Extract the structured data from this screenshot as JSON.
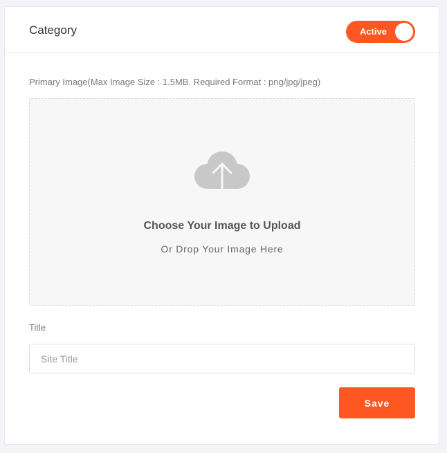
{
  "header": {
    "title": "Category",
    "status_toggle": {
      "label": "Active",
      "on": true
    }
  },
  "image_upload": {
    "label": "Primary Image(Max Image Size : 1.5MB. Required Format : png/jpg/jpeg)",
    "title": "Choose Your Image to Upload",
    "subtitle": "Or Drop Your Image Here",
    "icon": "cloud-upload-icon"
  },
  "title_field": {
    "label": "Title",
    "placeholder": "Site Title",
    "value": ""
  },
  "actions": {
    "save_label": "Save"
  },
  "colors": {
    "accent": "#ff5722",
    "background": "#f3f4f7",
    "card": "#ffffff",
    "dropzone": "#f7f7f7",
    "icon": "#c8c8c8"
  }
}
